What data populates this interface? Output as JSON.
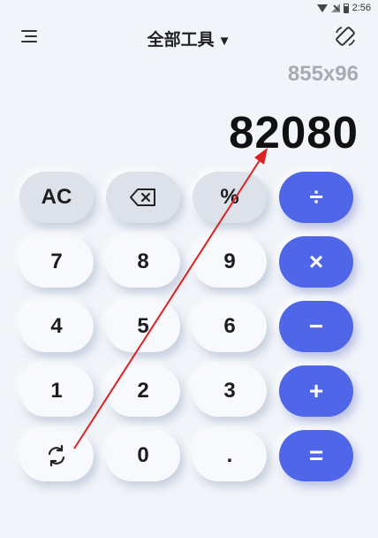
{
  "status_bar": {
    "time": "2:56"
  },
  "header": {
    "title": "全部工具",
    "dropdown_arrow": "▼"
  },
  "display": {
    "history": "855x96",
    "result": "82080"
  },
  "keys": {
    "ac": "AC",
    "percent": "%",
    "divide": "÷",
    "seven": "7",
    "eight": "8",
    "nine": "9",
    "multiply": "×",
    "four": "4",
    "five": "5",
    "six": "6",
    "minus": "−",
    "one": "1",
    "two": "2",
    "three": "3",
    "plus": "+",
    "zero": "0",
    "dot": ".",
    "equals": "="
  },
  "colors": {
    "accent": "#5066e8",
    "annotation_arrow": "#e02020",
    "background": "#f1f4f9",
    "key_gray": "#dde2ea"
  },
  "icons": {
    "menu": "menu-icon",
    "rotate": "screen-rotate-icon",
    "backspace": "backspace-icon",
    "refresh": "refresh-icon",
    "wifi": "wifi-icon",
    "signal": "signal-icon",
    "battery": "battery-icon"
  }
}
